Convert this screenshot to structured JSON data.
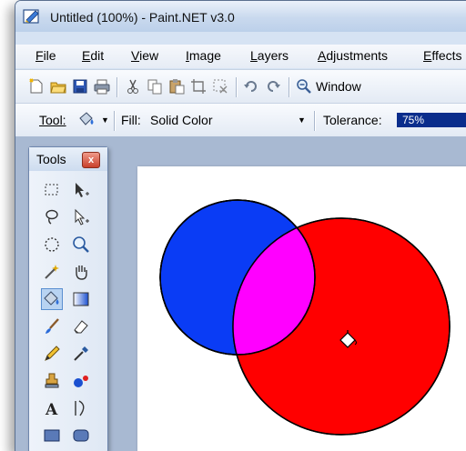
{
  "window": {
    "title": "Untitled (100%) - Paint.NET v3.0"
  },
  "menu": {
    "items": [
      "File",
      "Edit",
      "View",
      "Image",
      "Layers",
      "Adjustments",
      "Effects"
    ]
  },
  "toolbar": {
    "window_label": "Window"
  },
  "options": {
    "tool_label": "Tool:",
    "fill_label": "Fill:",
    "fill_value": "Solid Color",
    "tolerance_label": "Tolerance:",
    "tolerance_value": "75%"
  },
  "tools_panel": {
    "title": "Tools",
    "close": "x"
  },
  "colors": {
    "blue_circle": "#0a3cf5",
    "red_circle": "#ff0000",
    "overlap": "#ff00ff"
  }
}
